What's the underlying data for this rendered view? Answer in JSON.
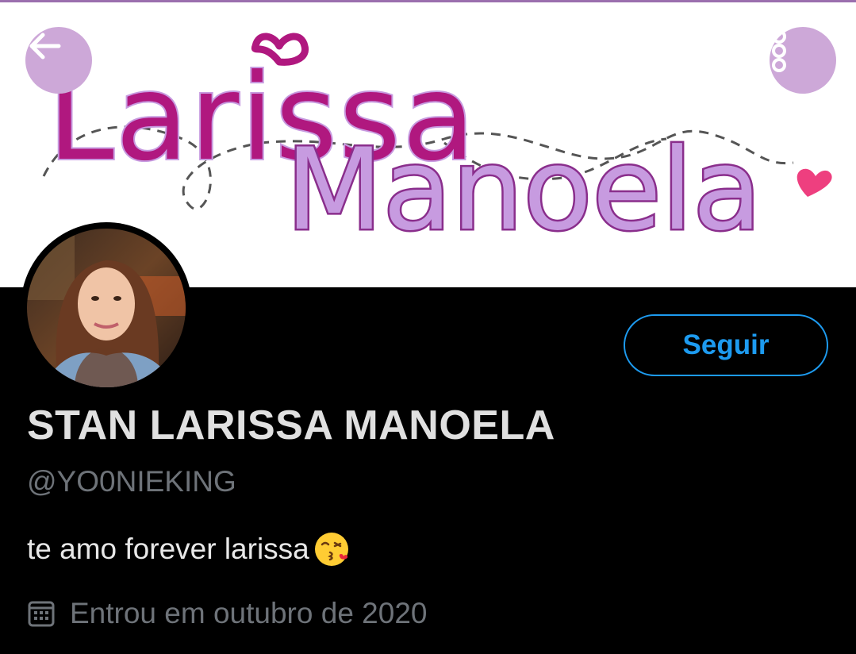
{
  "banner": {
    "line1": "Larissa",
    "line2": "Manoela",
    "brand_colors": {
      "magenta": "#b0187f",
      "lavender": "#c79be0",
      "heart": "#ee3f7f",
      "button": "#cda8d8"
    }
  },
  "header": {
    "back_icon": "arrow-left-icon",
    "menu_icon": "more-vertical-icon"
  },
  "profile": {
    "follow_label": "Seguir",
    "display_name": "STAN LARISSA MANOELA",
    "handle": "@YO0NIEKING",
    "bio": "te amo forever larissa",
    "bio_emoji": "kissing-face-emoji",
    "joined": "Entrou em outubro de 2020",
    "joined_icon": "calendar-icon",
    "accent_color": "#1d9bf0"
  }
}
